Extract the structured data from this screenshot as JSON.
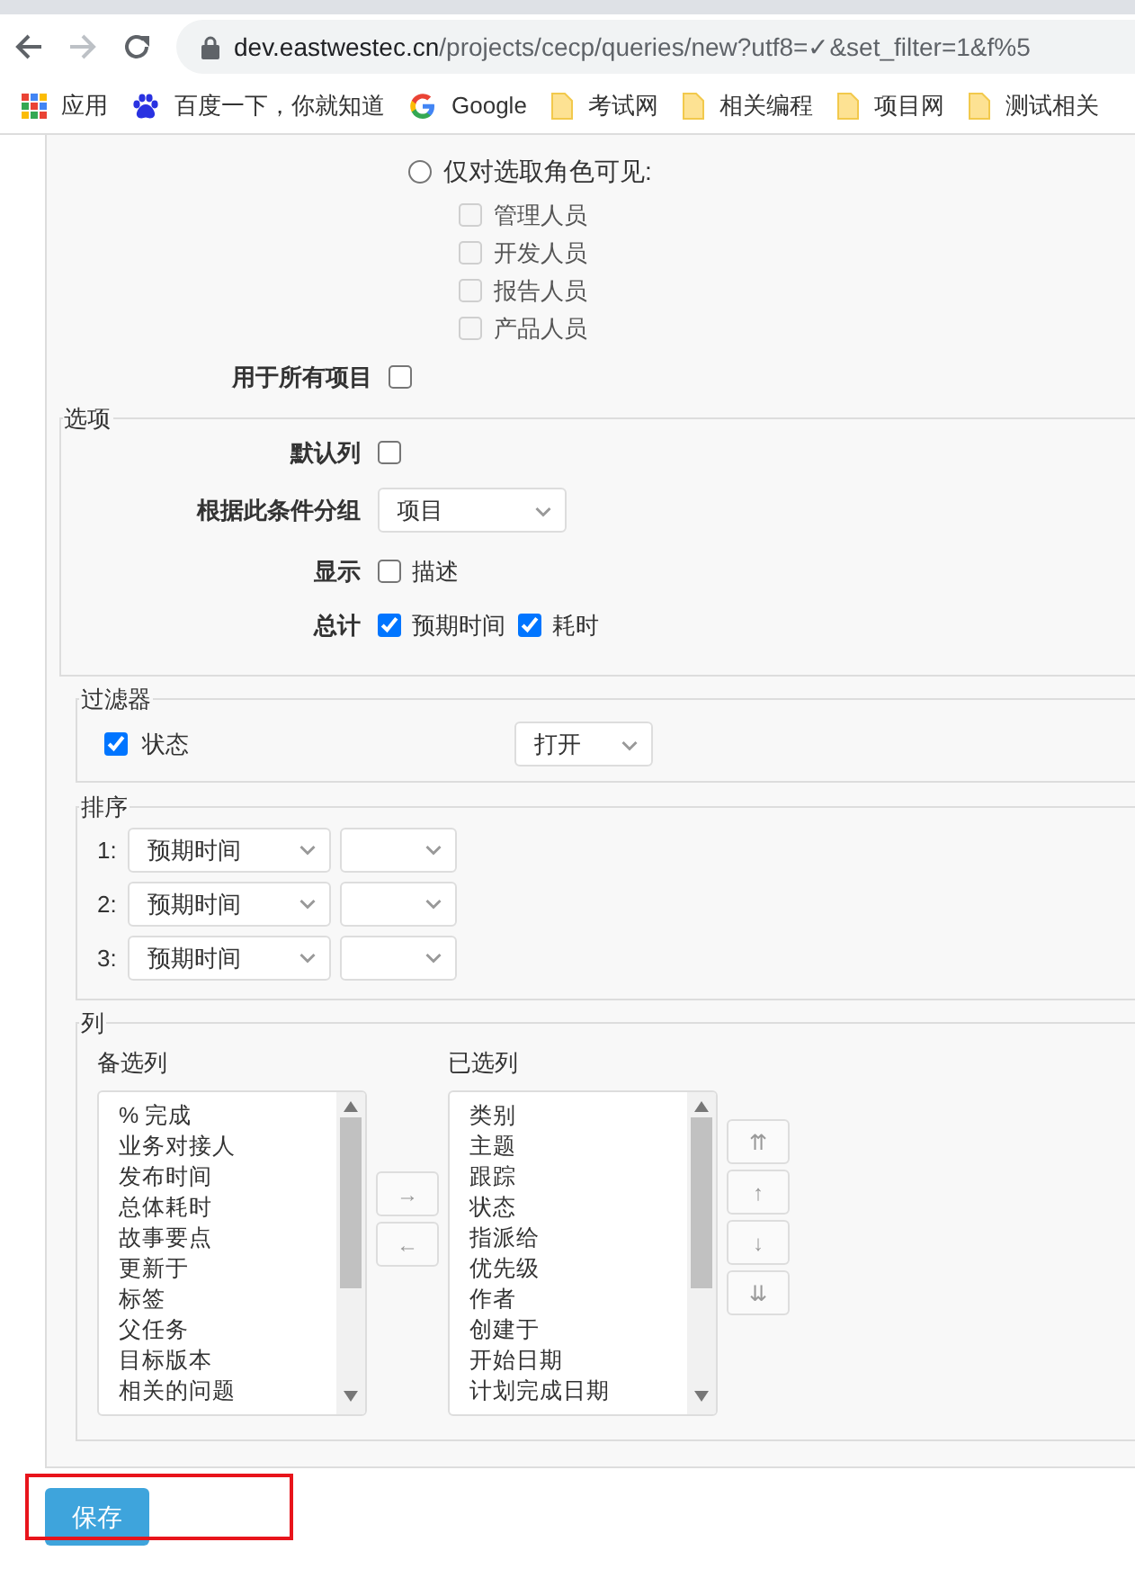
{
  "browser": {
    "url_host": "dev.eastwestec.cn",
    "url_path": "/projects/cecp/queries/new?utf8=✓&set_filter=1&f%5",
    "bookmarks": [
      {
        "label": "应用",
        "kind": "apps"
      },
      {
        "label": "百度一下，你就知道",
        "kind": "paw"
      },
      {
        "label": "Google",
        "kind": "google"
      },
      {
        "label": "考试网",
        "kind": "folder"
      },
      {
        "label": "相关编程",
        "kind": "folder"
      },
      {
        "label": "项目网",
        "kind": "folder"
      },
      {
        "label": "测试相关",
        "kind": "folder"
      }
    ]
  },
  "visibility": {
    "radio_label": "仅对选取角色可见:",
    "radio_selected": false,
    "roles": [
      {
        "label": "管理人员",
        "checked": false,
        "disabled": true
      },
      {
        "label": "开发人员",
        "checked": false,
        "disabled": true
      },
      {
        "label": "报告人员",
        "checked": false,
        "disabled": true
      },
      {
        "label": "产品人员",
        "checked": false,
        "disabled": true
      }
    ]
  },
  "all_projects": {
    "label": "用于所有项目",
    "checked": false
  },
  "options": {
    "legend": "选项",
    "default_columns": {
      "label": "默认列",
      "checked": false
    },
    "group_by": {
      "label": "根据此条件分组",
      "value": "项目"
    },
    "show": {
      "label": "显示",
      "items": [
        {
          "label": "描述",
          "checked": false
        }
      ]
    },
    "totals": {
      "label": "总计",
      "items": [
        {
          "label": "预期时间",
          "checked": true
        },
        {
          "label": "耗时",
          "checked": true
        }
      ]
    }
  },
  "filters": {
    "legend": "过滤器",
    "items": [
      {
        "label": "状态",
        "checked": true,
        "operator": "打开"
      }
    ]
  },
  "sort": {
    "legend": "排序",
    "rows": [
      {
        "index": "1:",
        "field": "预期时间"
      },
      {
        "index": "2:",
        "field": "预期时间"
      },
      {
        "index": "3:",
        "field": "预期时间"
      }
    ]
  },
  "columns": {
    "legend": "列",
    "available_label": "备选列",
    "available": [
      "% 完成",
      "业务对接人",
      "发布时间",
      "总体耗时",
      "故事要点",
      "更新于",
      "标签",
      "父任务",
      "目标版本",
      "相关的问题"
    ],
    "selected_label": "已选列",
    "selected": [
      "类别",
      "主题",
      "跟踪",
      "状态",
      "指派给",
      "优先级",
      "作者",
      "创建于",
      "开始日期",
      "计划完成日期"
    ],
    "move_buttons": [
      "→",
      "←"
    ],
    "order_buttons": [
      "⇈",
      "↑",
      "↓",
      "⇊"
    ]
  },
  "save_button": "保存"
}
